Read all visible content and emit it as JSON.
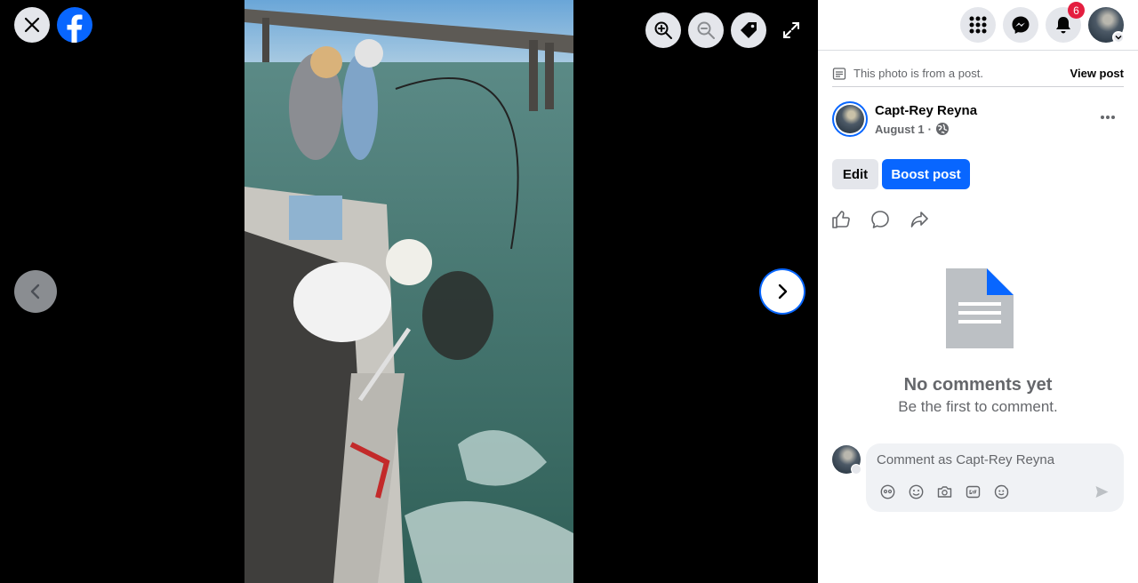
{
  "viewer": {
    "tools": [
      "close-icon",
      "facebook-logo",
      "zoom-in-icon",
      "zoom-out-icon",
      "tag-icon",
      "fullscreen-icon",
      "chevron-left-icon",
      "chevron-right-icon"
    ]
  },
  "topbar": {
    "notifications_count": "6",
    "icons": [
      "menu-grid-icon",
      "messenger-icon",
      "bell-icon"
    ]
  },
  "post": {
    "notice_text": "This photo is from a post.",
    "view_post_label": "View post",
    "author_name": "Capt-Rey Reyna",
    "date": "August 1",
    "separator": "·",
    "edit_label": "Edit",
    "boost_label": "Boost post"
  },
  "comments": {
    "empty_title": "No comments yet",
    "empty_subtitle": "Be the first to comment.",
    "placeholder": "Comment as Capt-Rey Reyna"
  },
  "colors": {
    "brand": "#0866ff",
    "badge": "#e41e3f",
    "button_grey": "#e4e6eb"
  }
}
